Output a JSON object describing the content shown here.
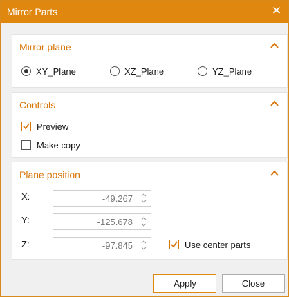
{
  "window": {
    "title": "Mirror Parts",
    "close_glyph": "✕",
    "accent": "#e0870f"
  },
  "mirror_plane": {
    "title": "Mirror plane",
    "collapse_icon": "chevron-up-icon",
    "options": [
      {
        "label": "XY_Plane",
        "selected": true
      },
      {
        "label": "XZ_Plane",
        "selected": false
      },
      {
        "label": "YZ_Plane",
        "selected": false
      }
    ]
  },
  "controls": {
    "title": "Controls",
    "collapse_icon": "chevron-up-icon",
    "preview": {
      "label": "Preview",
      "checked": true
    },
    "make_copy": {
      "label": "Make copy",
      "checked": false
    }
  },
  "plane_position": {
    "title": "Plane position",
    "collapse_icon": "chevron-up-icon",
    "x": {
      "label": "X:",
      "value": "-49.267"
    },
    "y": {
      "label": "Y:",
      "value": "-125.678"
    },
    "z": {
      "label": "Z:",
      "value": "-97.845"
    },
    "use_center": {
      "label": "Use center parts",
      "checked": true
    }
  },
  "footer": {
    "apply_label": "Apply",
    "close_label": "Close"
  }
}
